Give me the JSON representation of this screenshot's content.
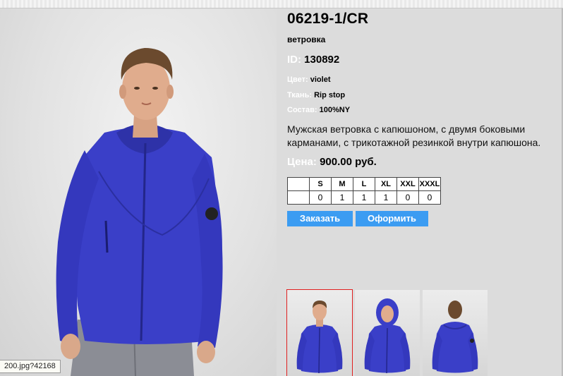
{
  "product": {
    "sku": "06219-1/CR",
    "type": "ветровка",
    "id_label": "ID:",
    "id_value": "130892",
    "color_label": "Цвет:",
    "color_value": "violet",
    "fabric_label": "Ткань:",
    "fabric_value": "Rip stop",
    "composition_label": "Состав:",
    "composition_value": "100%NY",
    "description": "Мужская ветровка с капюшоном, с двумя боковыми карманами, с трикотажной резинкой внутри капюшона.",
    "price_label": "Цена:",
    "price_value": "900.00 руб."
  },
  "sizes": {
    "headers": [
      "",
      "S",
      "M",
      "L",
      "XL",
      "XXL",
      "XXXL"
    ],
    "values": [
      "",
      "0",
      "1",
      "1",
      "1",
      "0",
      "0"
    ]
  },
  "buttons": {
    "order": "Заказать",
    "checkout": "Оформить"
  },
  "status_url": "200.jpg?42168",
  "thumbnails": [
    {
      "view": "front",
      "selected": true
    },
    {
      "view": "hood-up",
      "selected": false
    },
    {
      "view": "back",
      "selected": false
    }
  ],
  "colors": {
    "jacket": "#3a3fc8",
    "button": "#3b9cf2",
    "panel": "#dcdcdc",
    "thumb_selected_border": "#e02020"
  }
}
